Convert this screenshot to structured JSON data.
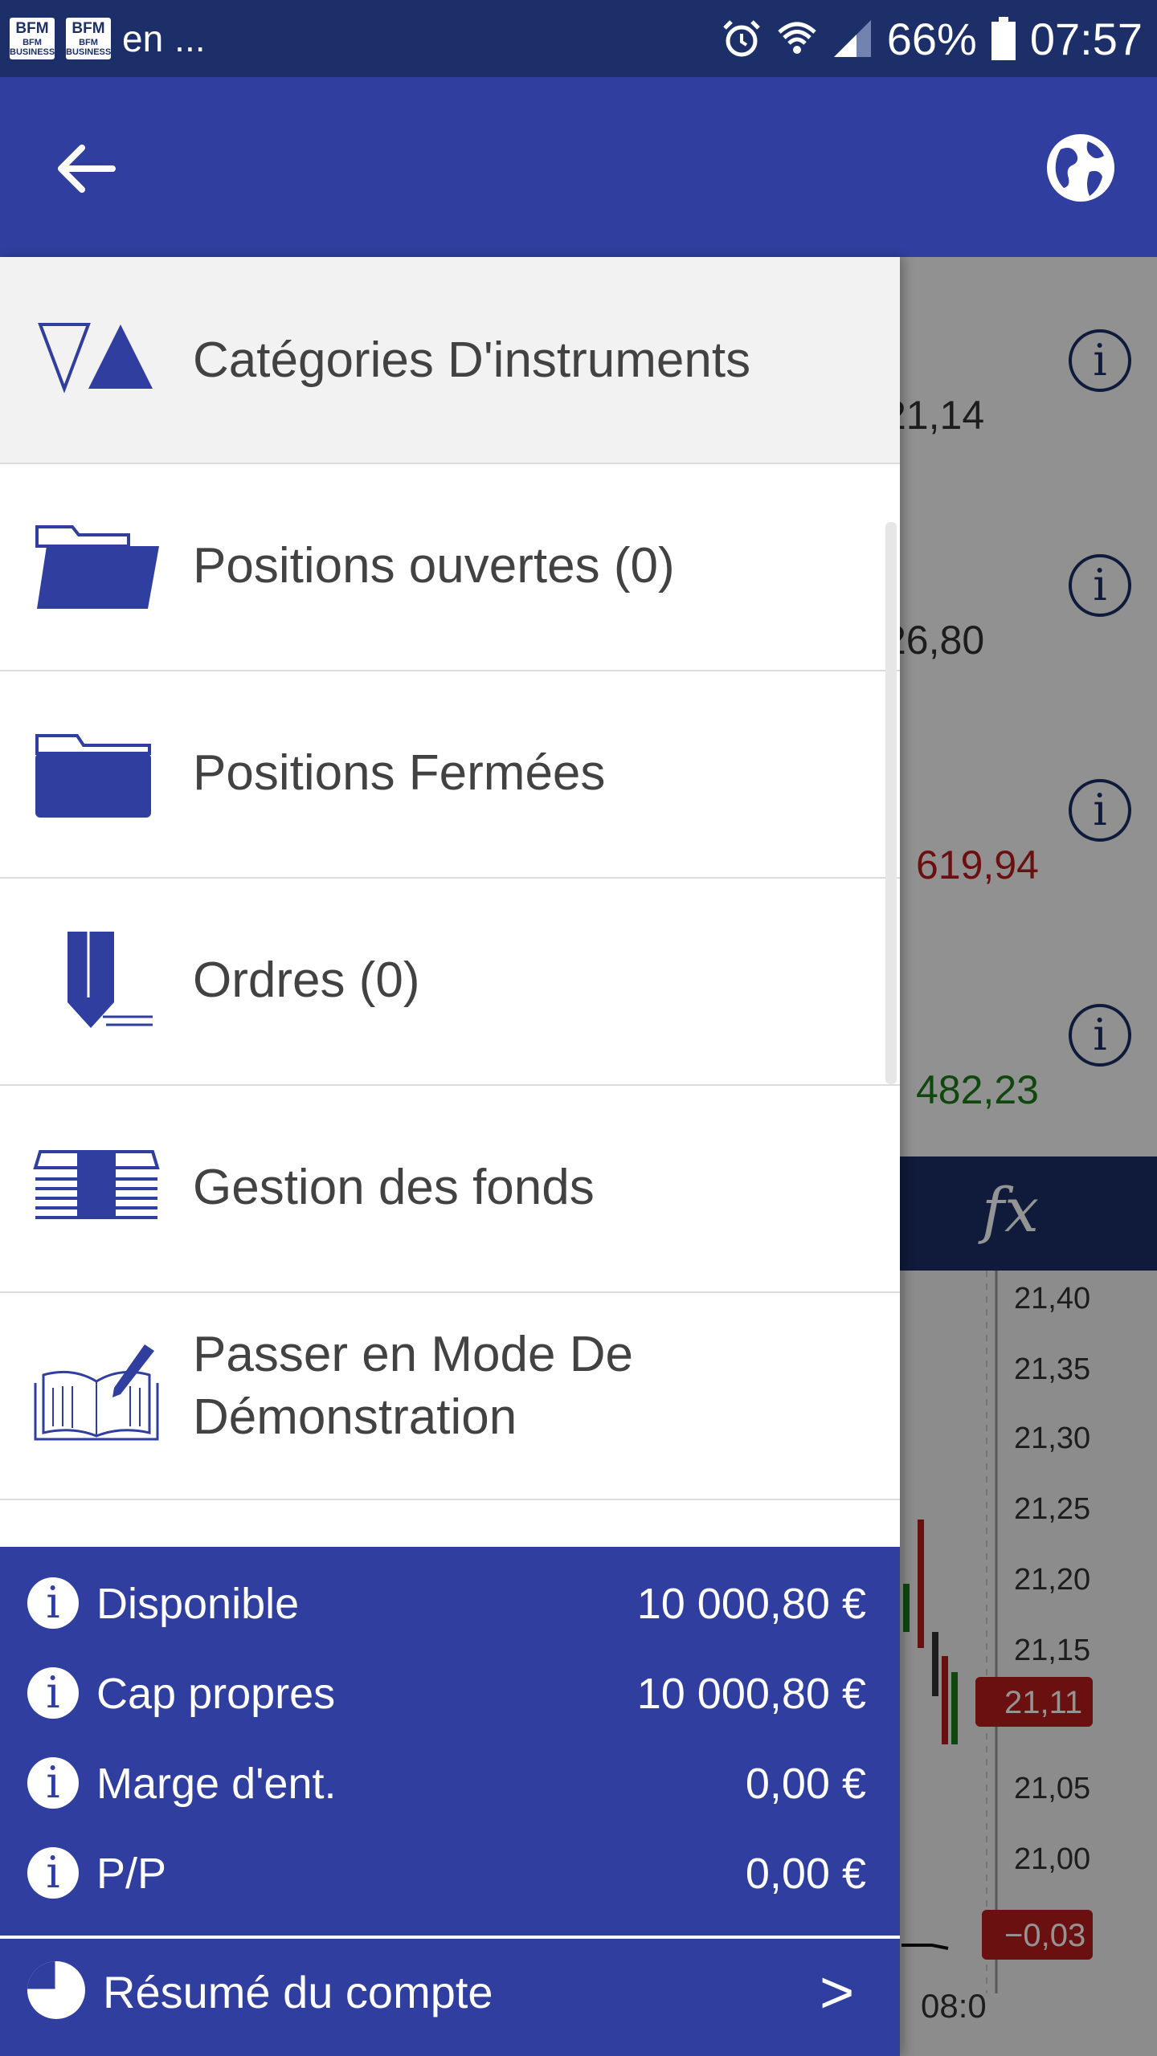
{
  "status_bar": {
    "apps": [
      "BFM BUSINESS",
      "BFM BUSINESS"
    ],
    "lang": "en",
    "more": "...",
    "battery": "66%",
    "time": "07:57"
  },
  "app_bar": {
    "back_icon": "arrow-left-icon",
    "globe_icon": "globe-icon"
  },
  "background": {
    "prices": [
      "21,14",
      "26,80",
      "619,94",
      "482,23"
    ],
    "price_colors": [
      "#333333",
      "#333333",
      "#b71c1c",
      "#1b7a1b"
    ],
    "chart_ticks": [
      "21,40",
      "21,35",
      "21,30",
      "21,25",
      "21,20",
      "21,15",
      "21,05",
      "21,00"
    ],
    "current_price": "21,11",
    "change": "−0,03",
    "time_label": "08:0",
    "fx_label": "fx"
  },
  "menu": [
    {
      "label": "Catégories D'instruments",
      "icon": "triangles-icon",
      "active": true
    },
    {
      "label": "Positions ouvertes (0)",
      "icon": "open-folder-icon"
    },
    {
      "label": "Positions Fermées",
      "icon": "closed-folder-icon"
    },
    {
      "label": "Ordres (0)",
      "icon": "pencil-icon"
    },
    {
      "label": "Gestion des fonds",
      "icon": "money-stack-icon"
    },
    {
      "label": "Passer en Mode De Démonstration",
      "icon": "book-pen-icon"
    }
  ],
  "account": [
    {
      "label": "Disponible",
      "value": "10 000,80 €"
    },
    {
      "label": "Cap propres",
      "value": "10 000,80 €"
    },
    {
      "label": "Marge d'ent.",
      "value": "0,00 €"
    },
    {
      "label": "P/P",
      "value": "0,00 €"
    }
  ],
  "summary": {
    "label": "Résumé du compte",
    "arrow": ">"
  },
  "colors": {
    "primary": "#303f9f",
    "status_bar": "#1c2f68",
    "text": "#424242"
  }
}
